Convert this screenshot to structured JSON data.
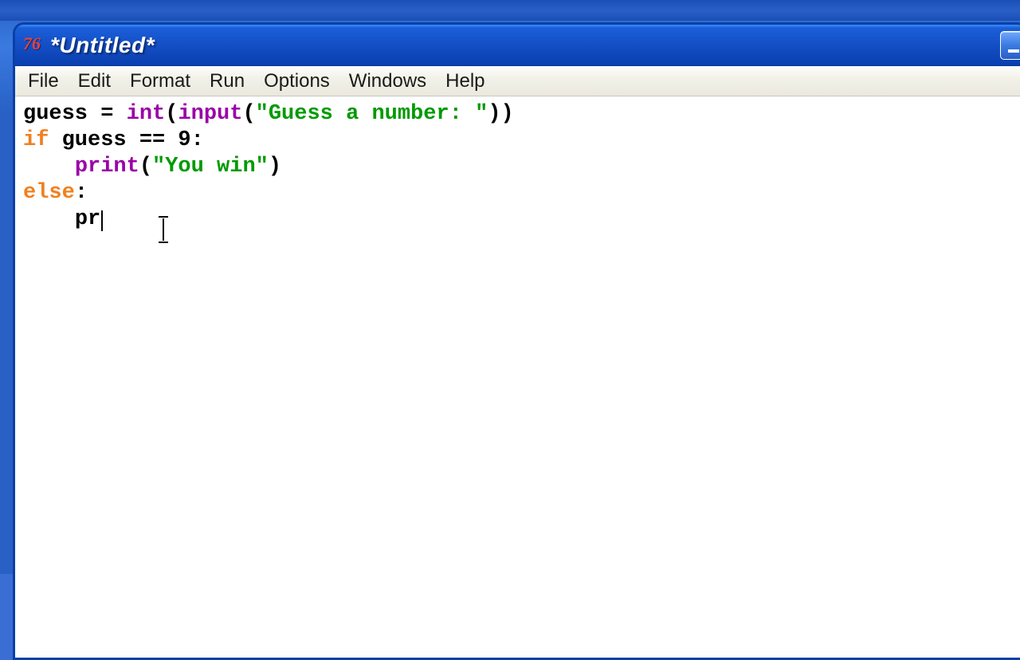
{
  "window": {
    "app_icon_glyph": "76",
    "title": "*Untitled*"
  },
  "menu": {
    "file": "File",
    "edit": "Edit",
    "format": "Format",
    "run": "Run",
    "options": "Options",
    "windows": "Windows",
    "help": "Help"
  },
  "code": {
    "line1": {
      "t1": "guess = ",
      "fn1": "int",
      "t2": "(",
      "fn2": "input",
      "t3": "(",
      "str": "\"Guess a number: \"",
      "t4": "))"
    },
    "line2": {
      "kw": "if",
      "body": " guess == 9:"
    },
    "line3": {
      "indent": "    ",
      "fn": "print",
      "t1": "(",
      "str": "\"You win\"",
      "t2": ")"
    },
    "line4": {
      "kw": "else",
      "t1": ":"
    },
    "line5": {
      "indent": "    ",
      "partial": "pr"
    }
  },
  "cursor": {
    "ibeam_left_px": "178",
    "ibeam_top_px": "150"
  }
}
